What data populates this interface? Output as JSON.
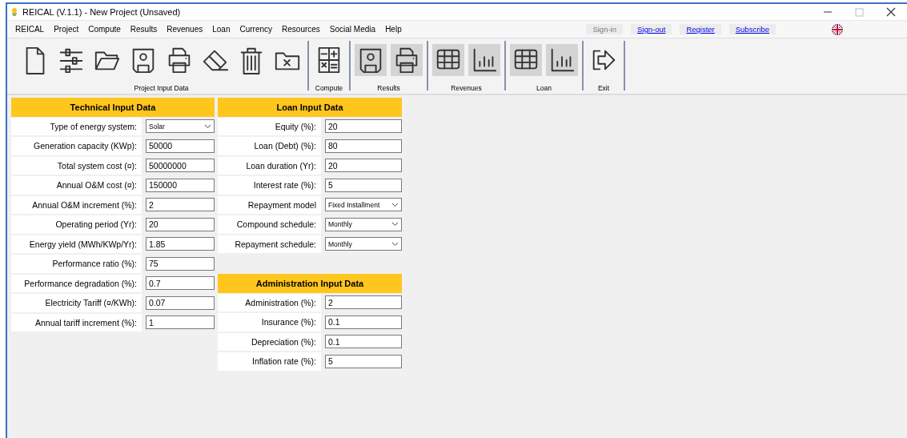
{
  "window": {
    "title": "REICAL (V.1.1) - New Project (Unsaved)"
  },
  "menu": [
    "REICAL",
    "Project",
    "Compute",
    "Results",
    "Revenues",
    "Loan",
    "Currency",
    "Resources",
    "Social Media",
    "Help"
  ],
  "account_links": [
    {
      "label": "Sign-in",
      "disabled": true
    },
    {
      "label": "Sign-out",
      "disabled": false
    },
    {
      "label": "Register",
      "disabled": false
    },
    {
      "label": "Subscribe",
      "disabled": false
    }
  ],
  "toolbar": [
    {
      "label": "Project Input Data",
      "buttons": [
        {
          "kind": "new"
        },
        {
          "kind": "settings"
        },
        {
          "kind": "open"
        },
        {
          "kind": "save",
          "highlighted": false
        },
        {
          "kind": "print",
          "highlighted": false
        },
        {
          "kind": "eraser"
        },
        {
          "kind": "trash"
        },
        {
          "kind": "close-file"
        }
      ]
    },
    {
      "label": "Compute",
      "buttons": [
        {
          "kind": "calculator"
        }
      ]
    },
    {
      "label": "Results",
      "buttons": [
        {
          "kind": "save",
          "highlighted": true
        },
        {
          "kind": "print",
          "highlighted": true
        }
      ]
    },
    {
      "label": "Revenues",
      "buttons": [
        {
          "kind": "table",
          "highlighted": true
        },
        {
          "kind": "chart",
          "highlighted": true
        }
      ]
    },
    {
      "label": "Loan",
      "buttons": [
        {
          "kind": "table",
          "highlighted": true
        },
        {
          "kind": "chart",
          "highlighted": true
        }
      ]
    },
    {
      "label": "Exit",
      "buttons": [
        {
          "kind": "exit"
        }
      ]
    }
  ],
  "technical": {
    "title": "Technical Input Data",
    "rows": [
      {
        "label": "Type of energy system:",
        "value": "Solar",
        "kind": "select"
      },
      {
        "label": "Generation capacity (KWp):",
        "value": "50000",
        "kind": "text"
      },
      {
        "label": "Total system cost (¤):",
        "value": "50000000",
        "kind": "text"
      },
      {
        "label": "Annual O&M cost (¤):",
        "value": "150000",
        "kind": "text"
      },
      {
        "label": "Annual O&M increment (%):",
        "value": "2",
        "kind": "text"
      },
      {
        "label": "Operating period (Yr):",
        "value": "20",
        "kind": "text"
      },
      {
        "label": "Energy yield (MWh/KWp/Yr):",
        "value": "1.85",
        "kind": "text"
      },
      {
        "label": "Performance ratio (%):",
        "value": "75",
        "kind": "text"
      },
      {
        "label": "Performance degradation (%):",
        "value": "0.7",
        "kind": "text"
      },
      {
        "label": "Electricity Tariff (¤/KWh):",
        "value": "0.07",
        "kind": "text"
      },
      {
        "label": "Annual tariff increment (%):",
        "value": "1",
        "kind": "text"
      }
    ]
  },
  "loan": {
    "title": "Loan Input Data",
    "rows": [
      {
        "label": "Equity (%):",
        "value": "20",
        "kind": "text"
      },
      {
        "label": "Loan (Debt) (%):",
        "value": "80",
        "kind": "text"
      },
      {
        "label": "Loan duration (Yr):",
        "value": "20",
        "kind": "text"
      },
      {
        "label": "Interest rate (%):",
        "value": "5",
        "kind": "text"
      },
      {
        "label": "Repayment model",
        "value": "Fixed Installment",
        "kind": "select"
      },
      {
        "label": "Compound schedule:",
        "value": "Monthly",
        "kind": "select"
      },
      {
        "label": "Repayment schedule:",
        "value": "Monthly",
        "kind": "select"
      }
    ]
  },
  "administration": {
    "title": "Administration Input Data",
    "rows": [
      {
        "label": "Administration (%):",
        "value": "2",
        "kind": "text"
      },
      {
        "label": "Insurance (%):",
        "value": "0.1",
        "kind": "text"
      },
      {
        "label": "Depreciation (%):",
        "value": "0.1",
        "kind": "text"
      },
      {
        "label": "Inflation rate (%):",
        "value": "5",
        "kind": "text"
      }
    ]
  }
}
